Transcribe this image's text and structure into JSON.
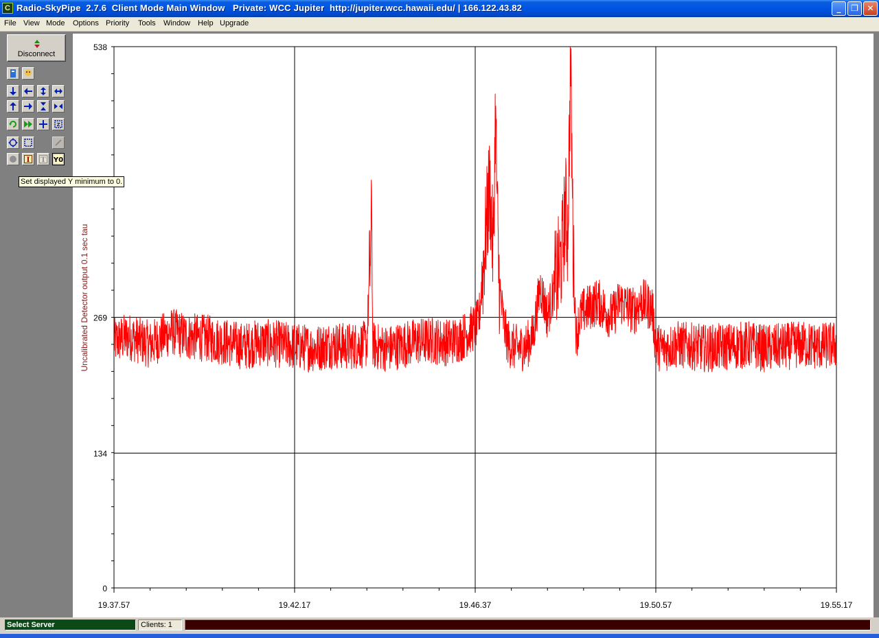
{
  "window": {
    "icon_letter": "C",
    "title": "Radio-SkyPipe  2.7.6  Client Mode Main Window   Private: WCC Jupiter  http://jupiter.wcc.hawaii.edu/ | 166.122.43.82",
    "minimize_glyph": "_",
    "maximize_glyph": "❐",
    "close_glyph": "✕"
  },
  "menu": [
    "File",
    "View",
    "Mode",
    "Options",
    "Priority",
    "Tools",
    "Window",
    "Help",
    "Upgrade"
  ],
  "toolbar": {
    "disconnect_label": "Disconnect",
    "tooltip": "Set displayed Y minimum to 0."
  },
  "status": {
    "server": "Select Server",
    "clients": "Clients:  1"
  },
  "chart_data": {
    "type": "line",
    "title": "",
    "xlabel": "",
    "ylabel": "Uncalibrated  Detector output 0.1 sec tau",
    "ylim": [
      0,
      538
    ],
    "y_ticks": [
      "538",
      "269",
      "134",
      "0"
    ],
    "y_tick_values": [
      538,
      269,
      134,
      0
    ],
    "x_tick_labels": [
      "19.37.57",
      "19.42.17",
      "19.46.37",
      "19.50.57",
      "19.55.17"
    ],
    "grid": true,
    "series_color": "#ff0000",
    "series": [
      {
        "x": [
          0,
          0.02,
          0.05,
          0.08,
          0.1,
          0.13,
          0.15,
          0.18,
          0.2,
          0.22,
          0.25,
          0.28,
          0.3,
          0.32,
          0.35,
          0.357,
          0.358,
          0.36,
          0.38,
          0.4,
          0.42,
          0.44,
          0.46,
          0.48,
          0.5,
          0.505,
          0.51,
          0.52,
          0.525,
          0.528,
          0.532,
          0.535,
          0.54,
          0.545,
          0.55,
          0.56,
          0.57,
          0.58,
          0.59,
          0.6,
          0.61,
          0.62,
          0.625,
          0.628,
          0.632,
          0.636,
          0.64,
          0.645,
          0.65,
          0.66,
          0.67,
          0.68,
          0.69,
          0.7,
          0.71,
          0.72,
          0.73,
          0.74,
          0.745,
          0.75,
          0.76,
          0.78,
          0.8,
          0.82,
          0.85,
          0.88,
          0.9,
          0.93,
          0.95,
          0.98,
          1.0
        ],
        "y": [
          245,
          250,
          242,
          255,
          250,
          248,
          245,
          240,
          244,
          243,
          240,
          238,
          242,
          240,
          242,
          370,
          245,
          240,
          238,
          242,
          245,
          246,
          244,
          248,
          260,
          265,
          310,
          400,
          330,
          475,
          320,
          290,
          260,
          245,
          240,
          238,
          240,
          250,
          300,
          270,
          300,
          330,
          380,
          350,
          520,
          320,
          250,
          270,
          275,
          280,
          285,
          275,
          270,
          285,
          280,
          275,
          285,
          280,
          278,
          240,
          238,
          242,
          240,
          238,
          240,
          242,
          238,
          240,
          242,
          240,
          242
        ]
      }
    ]
  }
}
